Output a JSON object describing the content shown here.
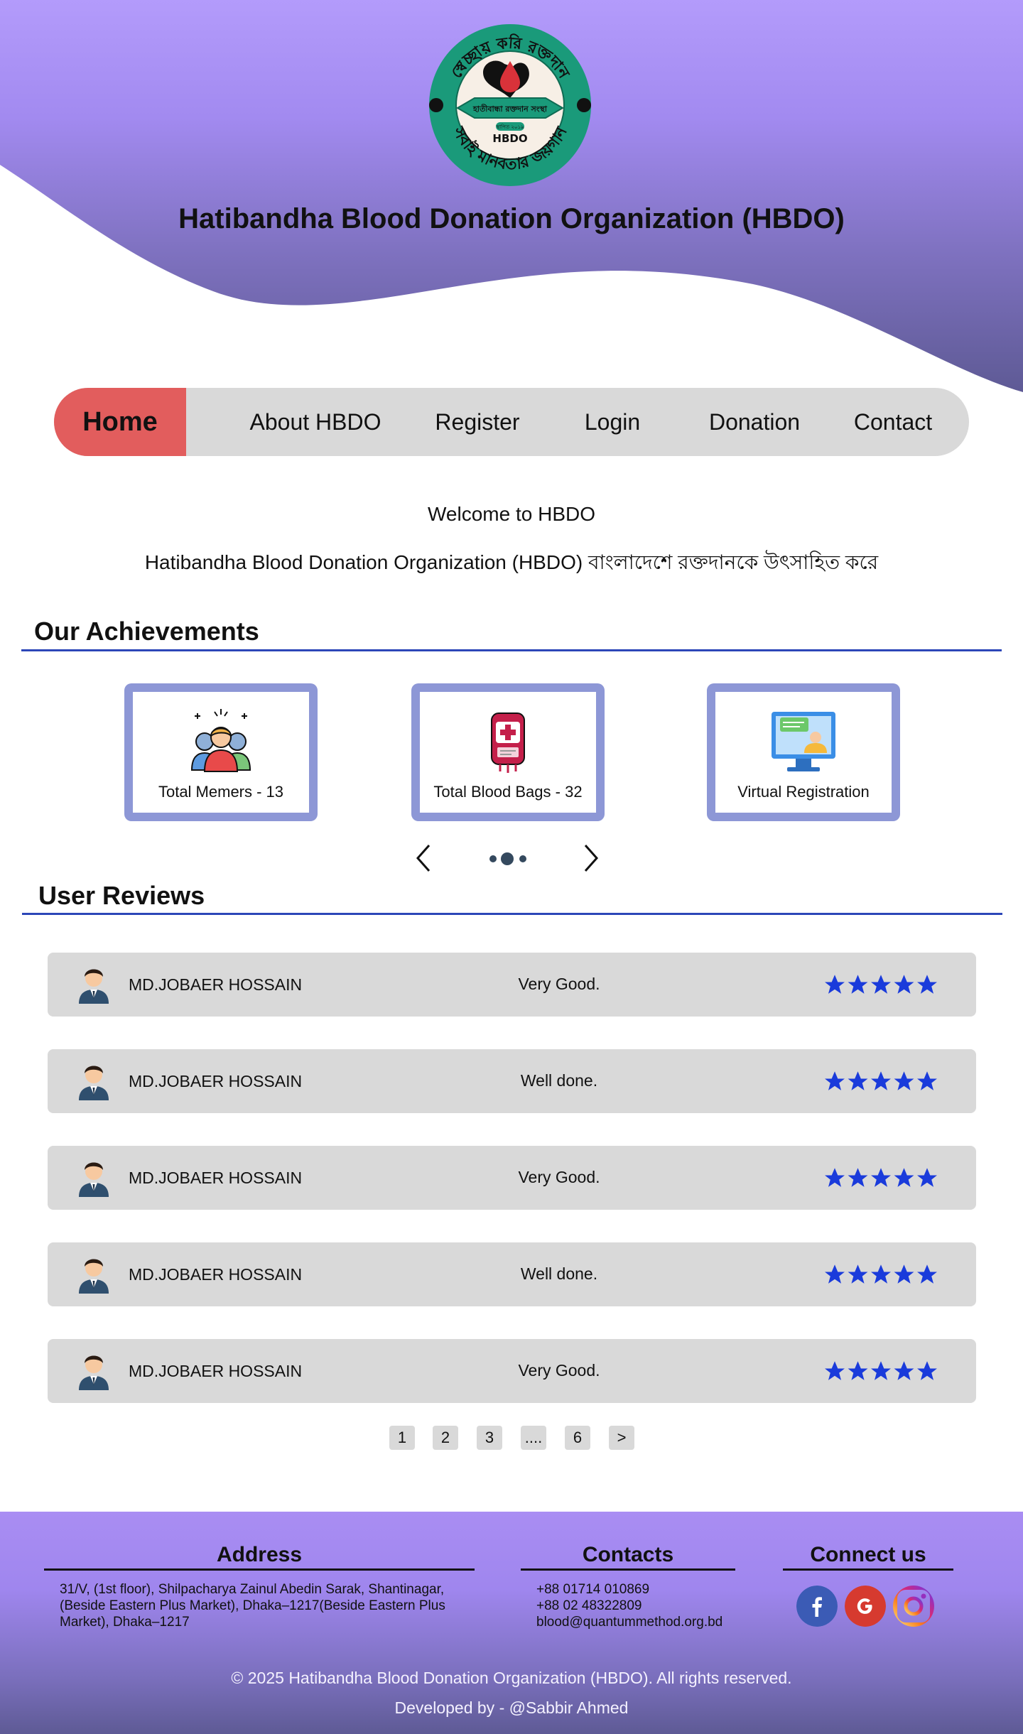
{
  "header": {
    "title": "Hatibandha Blood Donation Organization (HBDO)",
    "logo": {
      "top_text": "স্বেচ্ছায় করি রক্তদান",
      "ribbon_text": "হাতীবান্ধা রক্তদান সংস্থা",
      "small_text": "স্থাপিত ২০১৯",
      "abbr": "HBDO",
      "bottom_text": "সবাই মানবতার জয়গান"
    }
  },
  "nav": {
    "items": [
      {
        "label": "Home",
        "active": true
      },
      {
        "label": "About HBDO"
      },
      {
        "label": "Register"
      },
      {
        "label": "Login"
      },
      {
        "label": "Donation"
      },
      {
        "label": "Contact"
      }
    ]
  },
  "welcome": {
    "heading": "Welcome to HBDO",
    "text": "Hatibandha Blood Donation Organization (HBDO) বাংলাদেশে রক্তদানকে উৎসাহিত করে"
  },
  "achievements": {
    "title": "Our Achievements",
    "cards": [
      {
        "label": "Total Memers - 13",
        "icon": "team-icon"
      },
      {
        "label": "Total Blood Bags  - 32",
        "icon": "blood-bag-icon"
      },
      {
        "label": "Virtual Registration",
        "icon": "virtual-registration-icon"
      }
    ],
    "carousel": {
      "prev_icon": "chevron-left-icon",
      "next_icon": "chevron-right-icon",
      "active_dot": 2,
      "dots": 3
    }
  },
  "reviews": {
    "title": "User Reviews",
    "items": [
      {
        "name": "MD.JOBAER HOSSAIN",
        "comment": "Very Good.",
        "rating": 5
      },
      {
        "name": "MD.JOBAER HOSSAIN",
        "comment": "Well done.",
        "rating": 5
      },
      {
        "name": "MD.JOBAER HOSSAIN",
        "comment": "Very Good.",
        "rating": 5
      },
      {
        "name": "MD.JOBAER HOSSAIN",
        "comment": "Well done.",
        "rating": 5
      },
      {
        "name": "MD.JOBAER HOSSAIN",
        "comment": "Very Good.",
        "rating": 5
      }
    ],
    "pagination": [
      "1",
      "2",
      "3",
      "....",
      "6",
      ">"
    ]
  },
  "footer": {
    "address_title": "Address",
    "address_lines": [
      "31/V, (1st floor), Shilpacharya Zainul Abedin Sarak, Shantinagar,",
      "(Beside Eastern Plus Market), Dhaka–1217(Beside Eastern Plus",
      "Market), Dhaka–1217"
    ],
    "contacts_title": "Contacts",
    "contact_lines": [
      "+88 01714 010869",
      "+88 02 48322809",
      "blood@quantummethod.org.bd"
    ],
    "connect_title": "Connect us",
    "social": [
      {
        "name": "facebook-icon",
        "color": "#3b5bb5"
      },
      {
        "name": "google-icon",
        "color": "#d63a2f"
      },
      {
        "name": "instagram-icon",
        "color": "#c13584"
      }
    ],
    "copyright": "© 2025 Hatibandha Blood Donation Organization (HBDO). All rights reserved.",
    "developer": "Developed by - @Sabbir Ahmed"
  },
  "colors": {
    "accent": "#e25d5d",
    "hero_top": "#b39bfb",
    "hero_bottom": "#5e5a95",
    "rule": "#2c46b8",
    "card_border": "#8d97d6",
    "star": "#1a3bdb",
    "nav_bg": "#d9d9d9"
  }
}
